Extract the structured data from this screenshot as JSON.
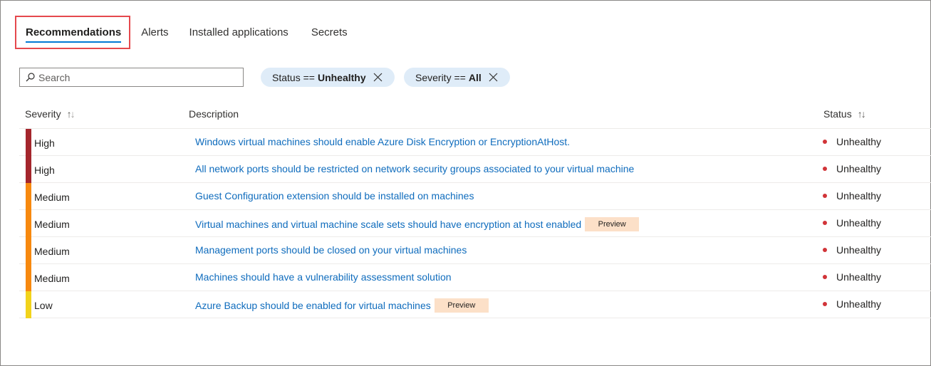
{
  "tabs": [
    {
      "label": "Recommendations",
      "active": true
    },
    {
      "label": "Alerts",
      "active": false
    },
    {
      "label": "Installed applications",
      "active": false
    },
    {
      "label": "Secrets",
      "active": false
    }
  ],
  "search": {
    "placeholder": "Search",
    "value": "",
    "icon": "search-icon"
  },
  "filters": [
    {
      "key": "Status",
      "op": "==",
      "value": "Unhealthy"
    },
    {
      "key": "Severity",
      "op": "==",
      "value": "All"
    }
  ],
  "table": {
    "columns": {
      "severity": "Severity",
      "description": "Description",
      "status": "Status"
    },
    "rows": [
      {
        "severity": "High",
        "description": "Windows virtual machines should enable Azure Disk Encryption or EncryptionAtHost.",
        "badge": "",
        "status": "Unhealthy"
      },
      {
        "severity": "High",
        "description": "All network ports should be restricted on network security groups associated to your virtual machine",
        "badge": "",
        "status": "Unhealthy"
      },
      {
        "severity": "Medium",
        "description": "Guest Configuration extension should be installed on machines",
        "badge": "",
        "status": "Unhealthy"
      },
      {
        "severity": "Medium",
        "description": "Virtual machines and virtual machine scale sets should have encryption at host enabled",
        "badge": "Preview",
        "status": "Unhealthy"
      },
      {
        "severity": "Medium",
        "description": "Management ports should be closed on your virtual machines",
        "badge": "",
        "status": "Unhealthy"
      },
      {
        "severity": "Medium",
        "description": "Machines should have a vulnerability assessment solution",
        "badge": "",
        "status": "Unhealthy"
      },
      {
        "severity": "Low",
        "description": "Azure Backup should be enabled for virtual machines",
        "badge": "Preview",
        "status": "Unhealthy"
      }
    ]
  },
  "colors": {
    "High": "#a4262c",
    "Medium": "#f7890f",
    "Low": "#f2d31b",
    "link": "#0f6cbd",
    "unhealthy_dot": "#d13438",
    "tab_highlight": "#e5484d",
    "pill_bg": "#dfecf8",
    "preview_badge_bg": "#fce0c8"
  }
}
